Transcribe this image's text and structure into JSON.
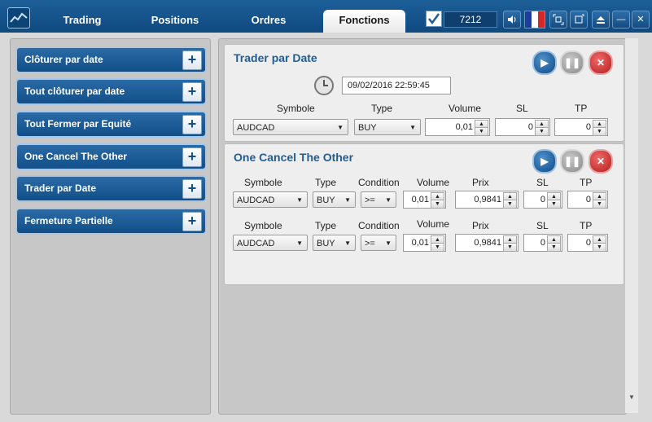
{
  "tabs": [
    {
      "label": "Trading"
    },
    {
      "label": "Positions"
    },
    {
      "label": "Ordres"
    },
    {
      "label": "Fonctions"
    }
  ],
  "header": {
    "counter": "7212",
    "check_icon": "✔",
    "sound_icon": "🔊",
    "min_icon": "—",
    "close_icon": "✕",
    "flag_colors": [
      "#1d3f9a",
      "#ffffff",
      "#d62828"
    ]
  },
  "sidebar": {
    "items": [
      {
        "label": "Clôturer par date"
      },
      {
        "label": "Tout clôturer par date"
      },
      {
        "label": "Tout Fermer par Equité"
      },
      {
        "label": "One Cancel The Other"
      },
      {
        "label": "Trader par Date"
      },
      {
        "label": "Fermeture Partielle"
      }
    ]
  },
  "trader_card": {
    "title": "Trader par Date",
    "datetime": "09/02/2016 22:59:45",
    "labels": {
      "symbole": "Symbole",
      "type": "Type",
      "volume": "Volume",
      "sl": "SL",
      "tp": "TP"
    },
    "symbol": "AUDCAD",
    "type": "BUY",
    "volume": "0,01",
    "sl": "0",
    "tp": "0"
  },
  "oco_card": {
    "title": "One Cancel The Other",
    "labels": {
      "symbole": "Symbole",
      "type": "Type",
      "condition": "Condition",
      "volume": "Volume",
      "prix": "Prix",
      "sl": "SL",
      "tp": "TP"
    },
    "rows": [
      {
        "symbol": "AUDCAD",
        "type": "BUY",
        "condition": ">=",
        "volume": "0,01",
        "prix": "0,9841",
        "sl": "0",
        "tp": "0"
      },
      {
        "symbol": "AUDCAD",
        "type": "BUY",
        "condition": ">=",
        "volume": "0,01",
        "prix": "0,9841",
        "sl": "0",
        "tp": "0"
      }
    ]
  },
  "controls": {
    "play": "▶",
    "pause": "❚❚",
    "stop": "✕",
    "plus": "+",
    "arrow_down": "▼",
    "arrow_up": "▲"
  }
}
